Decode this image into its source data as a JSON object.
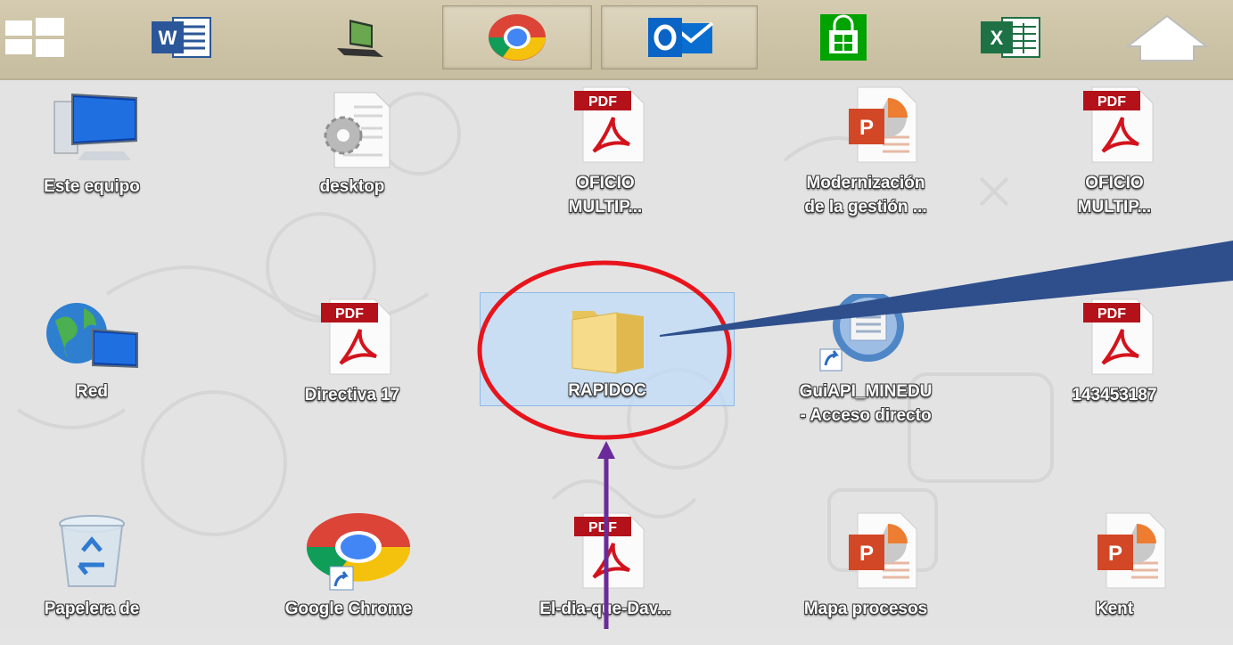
{
  "taskbar": {
    "buttons": [
      {
        "name": "start-icon"
      },
      {
        "name": "word-icon"
      },
      {
        "name": "laptop-icon"
      },
      {
        "name": "chrome-icon",
        "pressed": true
      },
      {
        "name": "outlook-icon",
        "pressed": true
      },
      {
        "name": "store-icon"
      },
      {
        "name": "excel-icon"
      },
      {
        "name": "home-icon"
      }
    ]
  },
  "pdf_badge": "PDF",
  "desktop": {
    "icons": [
      {
        "label": "Este equipo",
        "icon": "computer-icon"
      },
      {
        "label": "desktop",
        "icon": "settings-file-icon"
      },
      {
        "label_lines": [
          "OFICIO",
          "MULTIP..."
        ],
        "icon": "pdf-icon"
      },
      {
        "label_lines": [
          "Modernización",
          "de la gestión ..."
        ],
        "icon": "powerpoint-icon"
      },
      {
        "label_lines": [
          "OFICIO",
          "MULTIP..."
        ],
        "icon": "pdf-icon"
      },
      {
        "label": "Red",
        "icon": "network-icon"
      },
      {
        "label": "Directiva 17",
        "icon": "pdf-icon"
      },
      {
        "label": "RAPIDOC",
        "icon": "folder-icon",
        "selected": true
      },
      {
        "label_lines": [
          "GuiAPI_MINEDU",
          "- Acceso directo"
        ],
        "icon": "shortcut-app-icon"
      },
      {
        "label": "143453187",
        "icon": "pdf-icon"
      },
      {
        "label": "Papelera de",
        "icon": "recycle-bin-icon"
      },
      {
        "label": "Google Chrome",
        "icon": "chrome-icon"
      },
      {
        "label": "El-dia-que-Dav...",
        "icon": "pdf-icon"
      },
      {
        "label": "Mapa procesos",
        "icon": "powerpoint-icon"
      },
      {
        "label": "Kent",
        "icon": "powerpoint-icon"
      }
    ]
  },
  "annotations": {
    "highlight_color": "#e8141c",
    "callout_color": "#2e4f8c",
    "arrow_color": "#6b2a9a"
  }
}
